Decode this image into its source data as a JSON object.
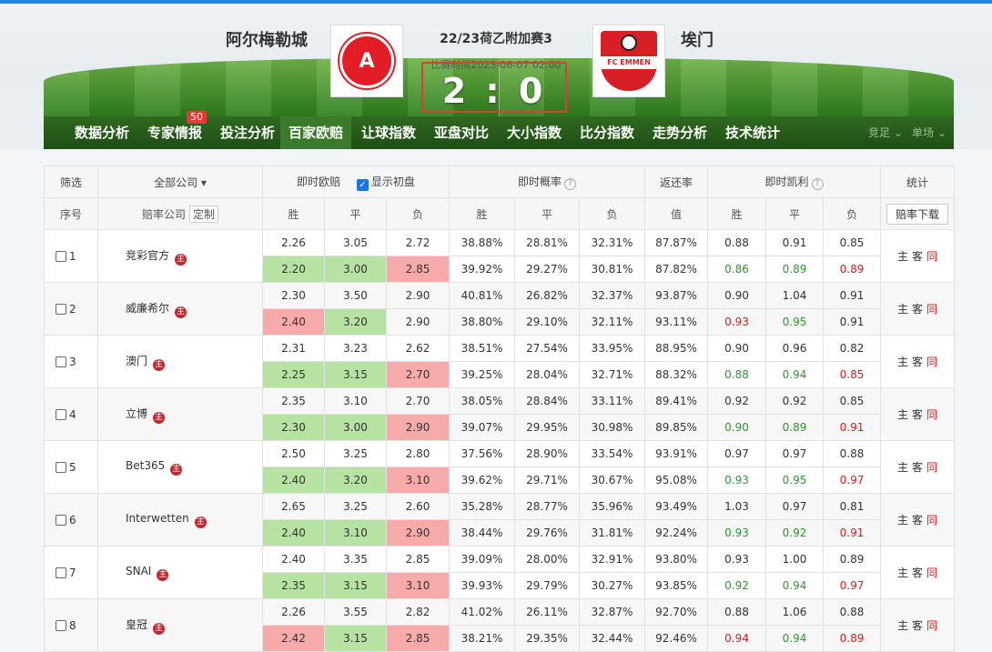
{
  "match": {
    "home": "阿尔梅勒城",
    "away": "埃门",
    "title": "22/23荷乙附加赛3",
    "time": "比赛时间2023-06-07 02:00",
    "score": "2 : 0",
    "home_logo_text": "A",
    "away_logo_text": "FC EMMEN"
  },
  "nav": {
    "items": [
      "数据分析",
      "专家情报",
      "投注分析",
      "百家欧赔",
      "让球指数",
      "亚盘对比",
      "大小指数",
      "比分指数",
      "走势分析",
      "技术统计"
    ],
    "badge": "50",
    "right1": "竞足",
    "right2": "单场"
  },
  "table": {
    "filter": "筛选",
    "all_companies": "全部公司",
    "live_euro": "即时欧赔",
    "show_initial": "显示初盘",
    "live_prob": "即时概率",
    "return_rate": "返还率",
    "live_kelly": "即时凯利",
    "stats": "统计",
    "seq": "序号",
    "company": "赔率公司",
    "customize": "定制",
    "win": "胜",
    "draw": "平",
    "lose": "负",
    "value": "值",
    "download": "赔率下载",
    "home": "主",
    "away": "客",
    "same": "同",
    "mark": "主"
  },
  "rows": [
    {
      "no": "1",
      "name": "竞彩官方",
      "top": [
        "2.26",
        "3.05",
        "2.72",
        "38.88%",
        "28.81%",
        "32.31%",
        "87.87%",
        "0.88",
        "0.91",
        "0.85"
      ],
      "bot": [
        "2.20",
        "3.00",
        "2.85",
        "39.92%",
        "29.27%",
        "30.81%",
        "87.82%",
        "0.86",
        "0.89",
        "0.89"
      ],
      "oc": [
        "g",
        "g",
        "r"
      ],
      "kc": [
        "g",
        "g",
        "r"
      ]
    },
    {
      "no": "2",
      "name": "威廉希尔",
      "top": [
        "2.30",
        "3.50",
        "2.90",
        "40.81%",
        "26.82%",
        "32.37%",
        "93.87%",
        "0.90",
        "1.04",
        "0.91"
      ],
      "bot": [
        "2.40",
        "3.20",
        "2.90",
        "38.80%",
        "29.10%",
        "32.11%",
        "93.11%",
        "0.93",
        "0.95",
        "0.91"
      ],
      "oc": [
        "r",
        "g",
        ""
      ],
      "kc": [
        "r",
        "g",
        ""
      ]
    },
    {
      "no": "3",
      "name": "澳门",
      "top": [
        "2.31",
        "3.23",
        "2.62",
        "38.51%",
        "27.54%",
        "33.95%",
        "88.95%",
        "0.90",
        "0.96",
        "0.82"
      ],
      "bot": [
        "2.25",
        "3.15",
        "2.70",
        "39.25%",
        "28.04%",
        "32.71%",
        "88.32%",
        "0.88",
        "0.94",
        "0.85"
      ],
      "oc": [
        "g",
        "g",
        "r"
      ],
      "kc": [
        "g",
        "g",
        "r"
      ]
    },
    {
      "no": "4",
      "name": "立博",
      "top": [
        "2.35",
        "3.10",
        "2.70",
        "38.05%",
        "28.84%",
        "33.11%",
        "89.41%",
        "0.92",
        "0.92",
        "0.85"
      ],
      "bot": [
        "2.30",
        "3.00",
        "2.90",
        "39.07%",
        "29.95%",
        "30.98%",
        "89.85%",
        "0.90",
        "0.89",
        "0.91"
      ],
      "oc": [
        "g",
        "g",
        "r"
      ],
      "kc": [
        "g",
        "g",
        "r"
      ]
    },
    {
      "no": "5",
      "name": "Bet365",
      "top": [
        "2.50",
        "3.25",
        "2.80",
        "37.56%",
        "28.90%",
        "33.54%",
        "93.91%",
        "0.97",
        "0.97",
        "0.88"
      ],
      "bot": [
        "2.40",
        "3.20",
        "3.10",
        "39.62%",
        "29.71%",
        "30.67%",
        "95.08%",
        "0.93",
        "0.95",
        "0.97"
      ],
      "oc": [
        "g",
        "g",
        "r"
      ],
      "kc": [
        "g",
        "g",
        "r"
      ]
    },
    {
      "no": "6",
      "name": "Interwetten",
      "top": [
        "2.65",
        "3.25",
        "2.60",
        "35.28%",
        "28.77%",
        "35.96%",
        "93.49%",
        "1.03",
        "0.97",
        "0.81"
      ],
      "bot": [
        "2.40",
        "3.10",
        "2.90",
        "38.44%",
        "29.76%",
        "31.81%",
        "92.24%",
        "0.93",
        "0.92",
        "0.91"
      ],
      "oc": [
        "g",
        "g",
        "r"
      ],
      "kc": [
        "g",
        "g",
        "r"
      ]
    },
    {
      "no": "7",
      "name": "SNAI",
      "top": [
        "2.40",
        "3.35",
        "2.85",
        "39.09%",
        "28.00%",
        "32.91%",
        "93.80%",
        "0.93",
        "1.00",
        "0.89"
      ],
      "bot": [
        "2.35",
        "3.15",
        "3.10",
        "39.93%",
        "29.79%",
        "30.27%",
        "93.85%",
        "0.92",
        "0.94",
        "0.97"
      ],
      "oc": [
        "g",
        "g",
        "r"
      ],
      "kc": [
        "g",
        "g",
        "r"
      ]
    },
    {
      "no": "8",
      "name": "皇冠",
      "top": [
        "2.26",
        "3.55",
        "2.82",
        "41.02%",
        "26.11%",
        "32.87%",
        "92.70%",
        "0.88",
        "1.06",
        "0.88"
      ],
      "bot": [
        "2.42",
        "3.15",
        "2.85",
        "38.21%",
        "29.35%",
        "32.44%",
        "92.46%",
        "0.94",
        "0.94",
        "0.89"
      ],
      "oc": [
        "r",
        "g",
        "r"
      ],
      "kc": [
        "r",
        "g",
        "r"
      ]
    }
  ]
}
